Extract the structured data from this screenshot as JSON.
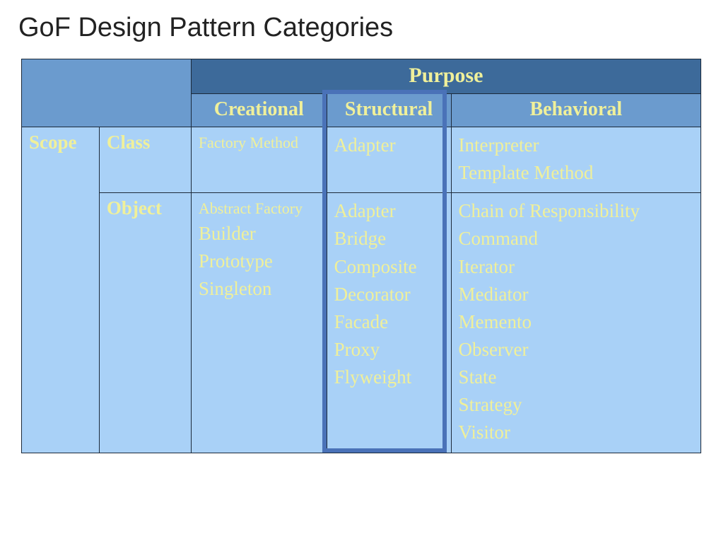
{
  "title": "GoF Design Pattern Categories",
  "headers": {
    "purpose": "Purpose",
    "scope": "Scope",
    "cols": {
      "creational": "Creational",
      "structural": "Structural",
      "behavioral": "Behavioral"
    },
    "rows": {
      "class": "Class",
      "object": "Object"
    }
  },
  "cells": {
    "class": {
      "creational": [
        "Factory Method"
      ],
      "structural": [
        "Adapter"
      ],
      "behavioral": [
        "Interpreter",
        "Template Method"
      ]
    },
    "object": {
      "creational": [
        "Abstract Factory",
        "Builder",
        "Prototype",
        "Singleton"
      ],
      "structural": [
        "Adapter",
        "Bridge",
        "Composite",
        "Decorator",
        "Facade",
        "Proxy",
        "Flyweight"
      ],
      "behavioral": [
        "Chain of Responsibility",
        "Command",
        "Iterator",
        "Mediator",
        "Memento",
        "Observer",
        "State",
        "Strategy",
        "Visitor"
      ]
    }
  },
  "highlight": {
    "column": "structural"
  }
}
